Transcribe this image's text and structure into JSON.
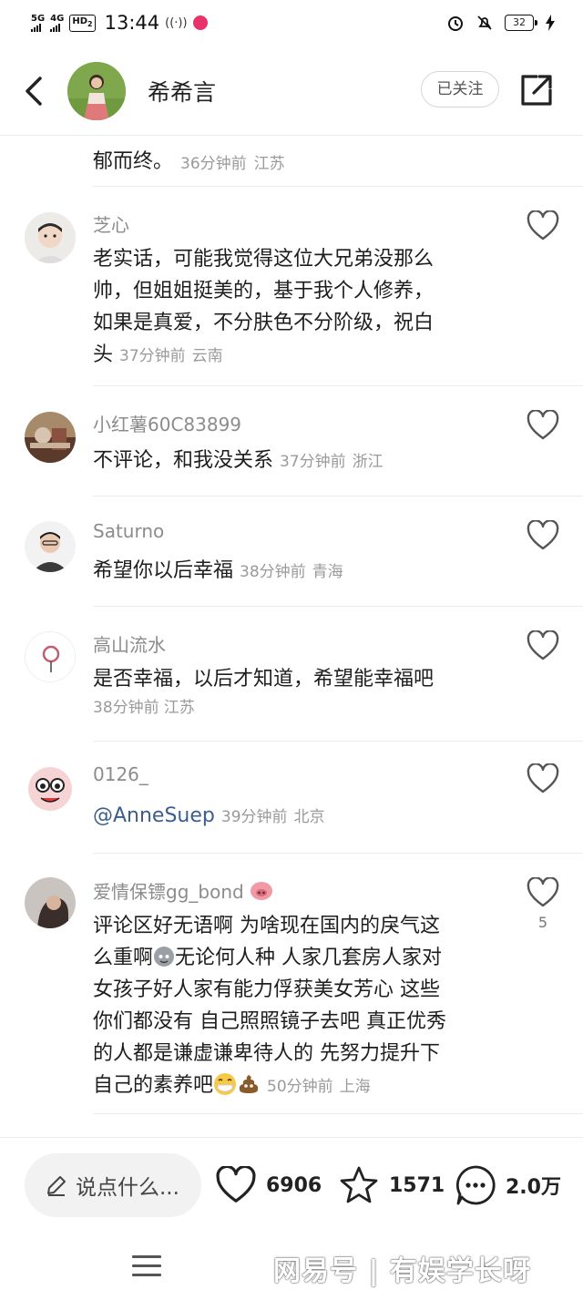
{
  "status_bar": {
    "signal1": "5G",
    "signal2": "4G",
    "hd": "HD",
    "hd_sub": "2",
    "time": "13:44",
    "battery": "32"
  },
  "header": {
    "name": "希希言",
    "follow_label": "已关注"
  },
  "prev_tail": {
    "text": "郁而终。",
    "time": "36分钟前",
    "location": "江苏"
  },
  "comments": [
    {
      "name": "芝心",
      "lines": [
        "老实话，可能我觉得这位大兄弟没那么",
        "帅，但姐姐挺美的，基于我个人修养，",
        "如果是真爱，不分肤色不分阶级，祝白"
      ],
      "last": "头",
      "time": "37分钟前",
      "location": "云南"
    },
    {
      "name": "小红薯60C83899",
      "text": "不评论，和我没关系",
      "time": "37分钟前",
      "location": "浙江"
    },
    {
      "name": "Saturno",
      "text": "希望你以后幸福",
      "time": "38分钟前",
      "location": "青海"
    },
    {
      "name": "高山流水",
      "text": "是否幸福，以后才知道，希望能幸福吧",
      "time": "38分钟前",
      "location": "江苏"
    },
    {
      "name": "0126_",
      "text": "@AnneSuep",
      "time": "39分钟前",
      "location": "北京"
    },
    {
      "name": "爱情保镖gg_bond",
      "lines": [
        "评论区好无语啊 为啥现在国内的戾气这",
        "么重啊",
        "无论何人种 人家几套房人家对",
        "女孩子好人家有能力俘获美女芳心 这些",
        "你们都没有 自己照照镜子去吧 真正优秀",
        "的人都是谦虚谦卑待人的 先努力提升下",
        "自己的素养吧"
      ],
      "time": "50分钟前",
      "location": "上海",
      "likes": "5"
    }
  ],
  "bottom": {
    "input_placeholder": "说点什么...",
    "likes": "6906",
    "stars": "1571",
    "comments": "2.0万"
  },
  "watermark": "网易号 | 有娱学长呀"
}
